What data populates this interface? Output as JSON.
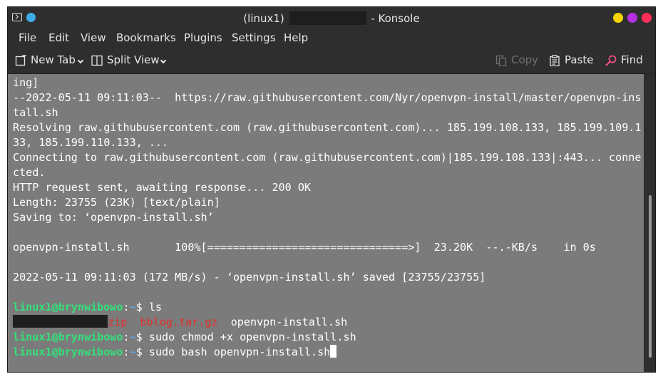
{
  "window": {
    "title_prefix": "(linux1)",
    "title_suffix": "- Konsole"
  },
  "menu": {
    "items": [
      "File",
      "Edit",
      "View",
      "Bookmarks",
      "Plugins",
      "Settings",
      "Help"
    ]
  },
  "toolbar": {
    "new_tab": "New Tab",
    "split_view": "Split View",
    "copy": "Copy",
    "paste": "Paste",
    "find": "Find"
  },
  "terminal": {
    "lines": [
      "ing]",
      "--2022-05-11 09:11:03--  https://raw.githubusercontent.com/Nyr/openvpn-install/master/openvpn-ins",
      "tall.sh",
      "Resolving raw.githubusercontent.com (raw.githubusercontent.com)... 185.199.108.133, 185.199.109.1",
      "33, 185.199.110.133, ...",
      "Connecting to raw.githubusercontent.com (raw.githubusercontent.com)|185.199.108.133|:443... conne",
      "cted.",
      "HTTP request sent, awaiting response... 200 OK",
      "Length: 23755 (23K) [text/plain]",
      "Saving to: ‘openvpn-install.sh’",
      "",
      "openvpn-install.sh       100%[===============================>]  23.20K  --.-KB/s    in 0s",
      "",
      "2022-05-11 09:11:03 (172 MB/s) - ‘openvpn-install.sh’ saved [23755/23755]",
      ""
    ],
    "prompt_user": "linux1@brynwibowo",
    "prompt_sep": ":",
    "prompt_path": "~",
    "prompt_symbol": "$ ",
    "cmd1": "ls",
    "ls_zip": "zip",
    "ls_tar": "bblog.tar.gz",
    "ls_sh": "openvpn-install.sh",
    "cmd2": "sudo chmod +x openvpn-install.sh",
    "cmd3": "sudo bash openvpn-install.sh"
  }
}
